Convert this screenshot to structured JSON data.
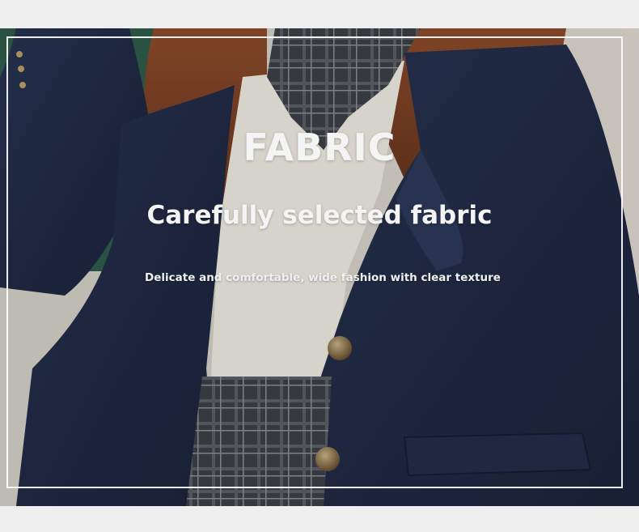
{
  "headline": "FABRIC",
  "subheadline": "Carefully selected fabric",
  "caption": "Delicate and comfortable, wide fashion with clear texture",
  "colors": {
    "background": "#efefef",
    "blazer": "#1f2a44",
    "shirt": "#e8e4da",
    "hair": "#7a3f22",
    "chalkboard": "#2f5a4a",
    "button": "#6e5a3a",
    "text": "#f4f4f4"
  }
}
